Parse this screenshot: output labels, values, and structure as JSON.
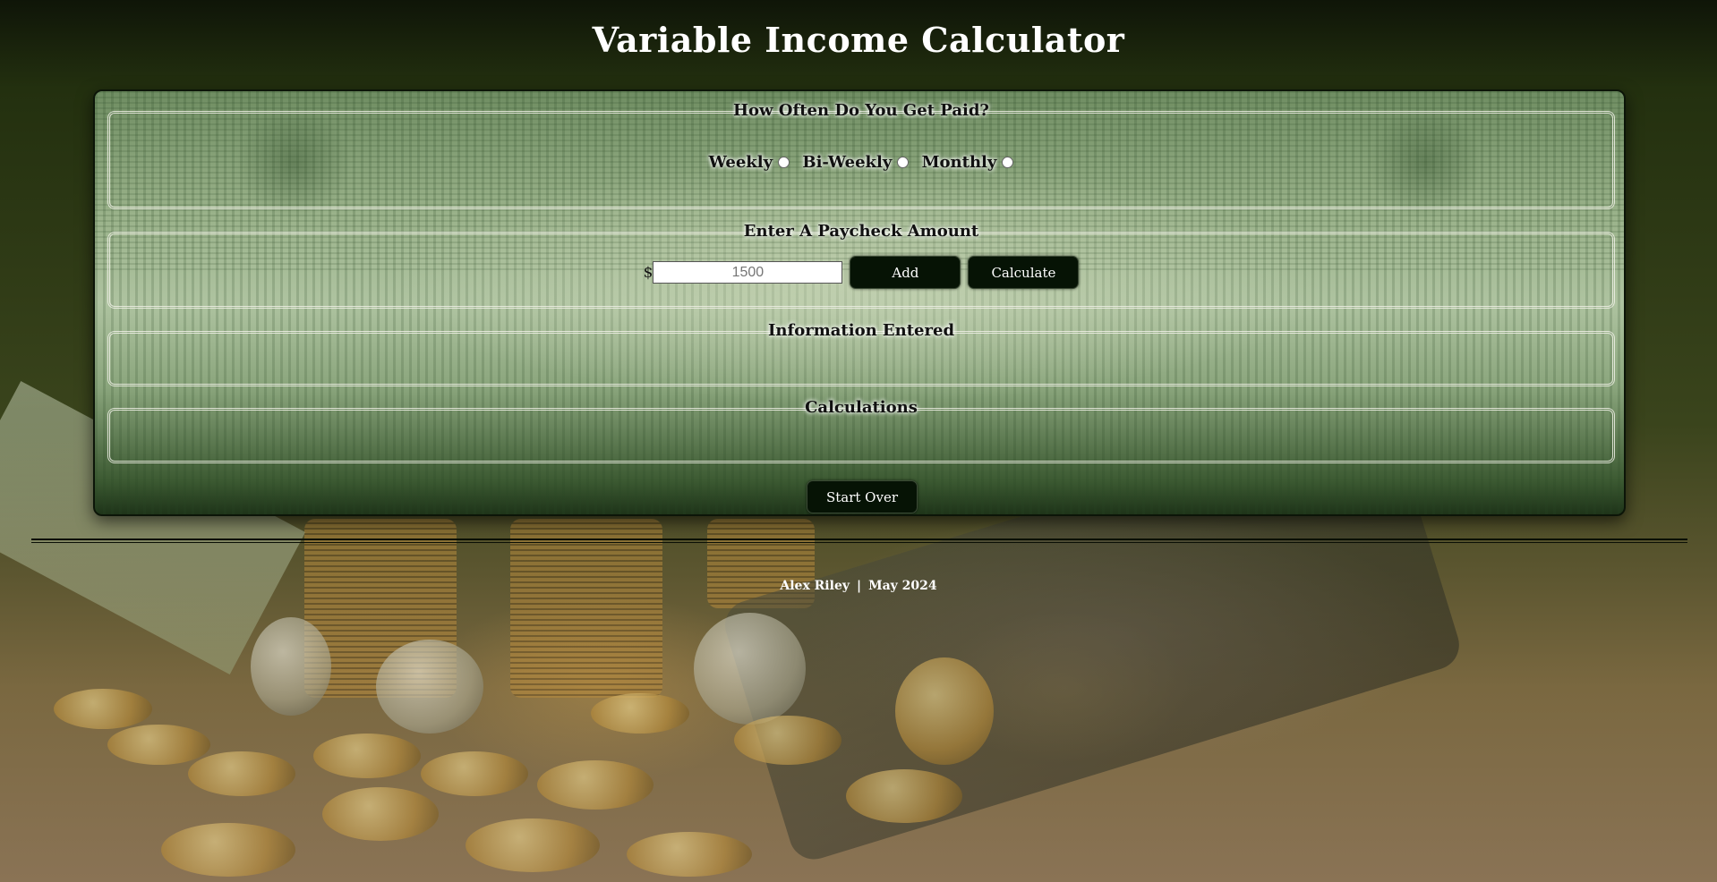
{
  "page": {
    "title": "Variable Income Calculator"
  },
  "frequency": {
    "legend": "How Often Do You Get Paid?",
    "options": [
      "Weekly",
      "Bi-Weekly",
      "Monthly"
    ]
  },
  "paycheck": {
    "legend": "Enter A Paycheck Amount",
    "currency_symbol": "$",
    "amount_placeholder": "1500",
    "add_label": "Add",
    "calculate_label": "Calculate"
  },
  "info": {
    "legend": "Information Entered"
  },
  "calculations": {
    "legend": "Calculations"
  },
  "actions": {
    "start_over_label": "Start Over"
  },
  "footer": {
    "author": "Alex Riley",
    "separator": "|",
    "date": "May 2024"
  },
  "theme": {
    "button_bg": "#061305",
    "panel_green": "#9bb38b"
  }
}
